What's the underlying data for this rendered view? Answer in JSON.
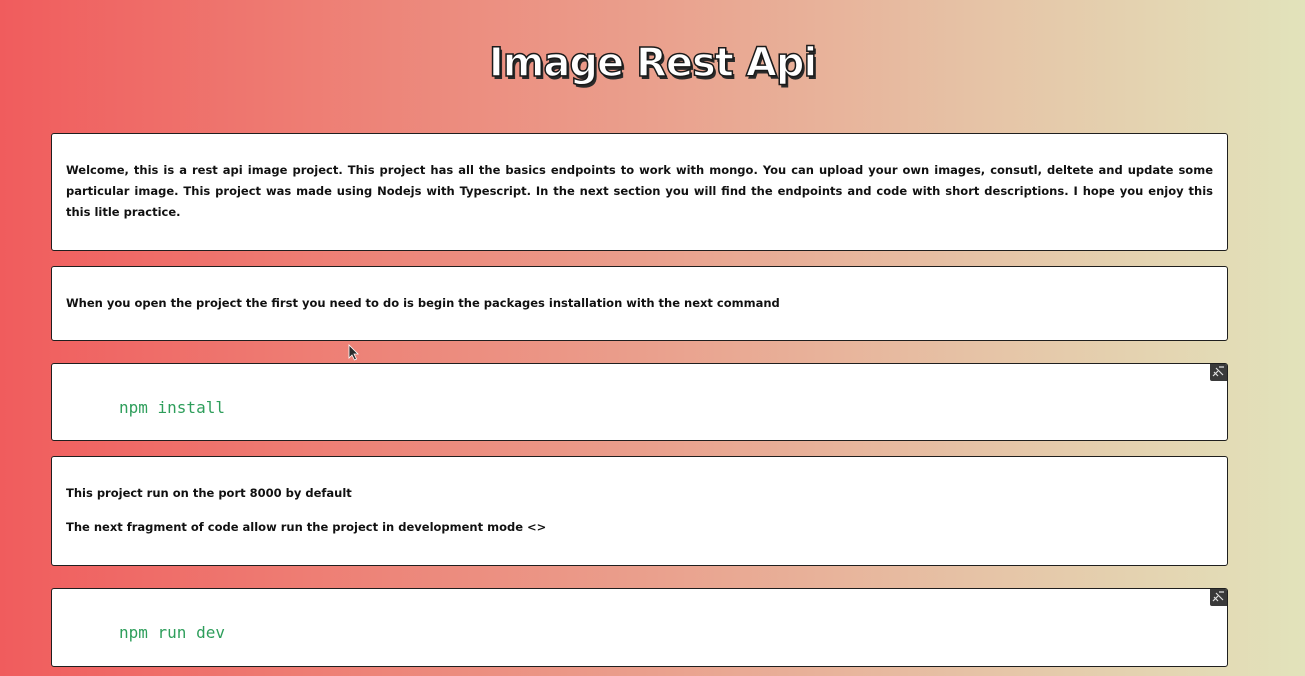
{
  "header": {
    "title": "Image Rest Api"
  },
  "intro": {
    "text": "Welcome, this is a rest api image project. This project has all the basics endpoints to work with mongo. You can upload your own images, consutl, deltete and update some particular image. This project was made using Nodejs with Typescript. In the next section you will find the endpoints and code with short descriptions. I hope you enjoy this this litle practice."
  },
  "install_info": {
    "text": "When you open the project the first you need to do is begin the packages installation with the next command"
  },
  "install_code": {
    "code": "npm install"
  },
  "port_info": {
    "line1": "This project run on the port 8000 by default",
    "line2": "The next fragment of code allow run the project in development mode <>"
  },
  "dev_code": {
    "code": "npm run dev"
  },
  "colors": {
    "gradient_start": "#f05c5d",
    "gradient_end": "#e2e3bb",
    "code_text": "#2e9e5b",
    "card_bg": "#ffffff"
  },
  "icons": {
    "copy": "copy-icon",
    "cursor": "mouse-cursor-icon"
  }
}
